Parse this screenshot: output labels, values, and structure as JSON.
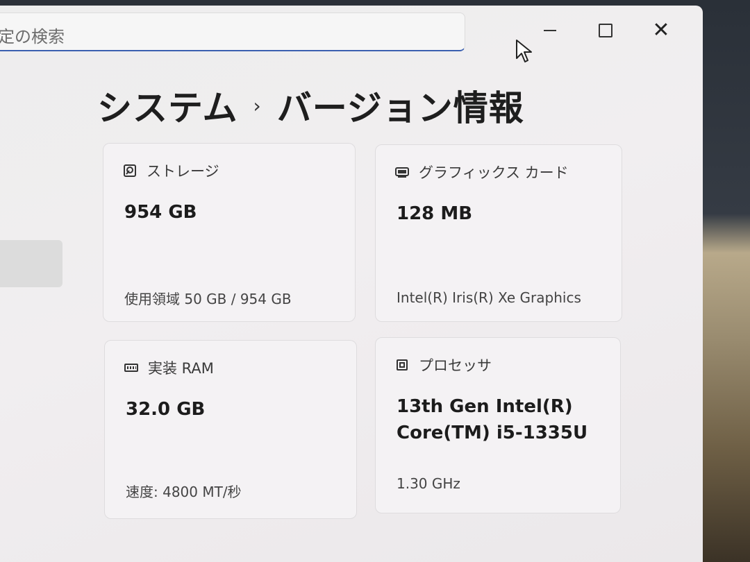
{
  "search": {
    "placeholder": "定の検索"
  },
  "window_controls": {
    "minimize": "minimize",
    "maximize": "maximize",
    "close": "close"
  },
  "breadcrumb": {
    "parent": "システム",
    "separator": "›",
    "current": "バージョン情報"
  },
  "cards": {
    "storage": {
      "label": "ストレージ",
      "value": "954 GB",
      "detail": "使用領域 50 GB / 954 GB",
      "icon": "storage-icon"
    },
    "graphics": {
      "label": "グラフィックス カード",
      "value": "128 MB",
      "detail": "Intel(R) Iris(R) Xe Graphics",
      "icon": "graphics-card-icon"
    },
    "ram": {
      "label": "実装 RAM",
      "value": "32.0 GB",
      "detail": "速度: 4800 MT/秒",
      "icon": "ram-icon"
    },
    "processor": {
      "label": "プロセッサ",
      "value_line1": "13th Gen Intel(R)",
      "value_line2": "Core(TM) i5-1335U",
      "detail": "1.30 GHz",
      "icon": "processor-icon"
    }
  }
}
